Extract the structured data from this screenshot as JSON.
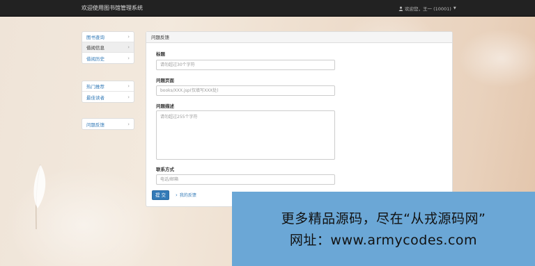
{
  "navbar": {
    "brand": "欢迎使用图书馆管理系统",
    "user_label": "欢迎您，王一 (10001)"
  },
  "sidebar": {
    "group1": [
      {
        "label": "图书查询",
        "active": false
      },
      {
        "label": "借阅信息",
        "active": true
      },
      {
        "label": "借阅历史",
        "active": false
      }
    ],
    "group2": [
      {
        "label": "热门推荐",
        "active": false
      },
      {
        "label": "最佳读者",
        "active": false
      }
    ],
    "group3": [
      {
        "label": "问题反馈",
        "active": false
      }
    ]
  },
  "panel": {
    "heading": "问题反馈",
    "title_label": "标题",
    "title_placeholder": "请勿超过30个字符",
    "page_label": "问题页面",
    "page_placeholder": "books/XXX.jsp(仅填写XXX处)",
    "desc_label": "问题描述",
    "desc_placeholder": "请勿超过255个字符",
    "contact_label": "联系方式",
    "contact_placeholder": "电话/邮箱",
    "submit_label": "提 交",
    "my_feedback_link": "我的反馈"
  },
  "watermark": {
    "line1": "更多精品源码，尽在“从戎源码网”",
    "line2": "网址：www.armycodes.com"
  },
  "colors": {
    "navbar_bg": "#222222",
    "link": "#337ab7",
    "primary_button": "#337ab7",
    "watermark_bg": "#6ba7d6"
  }
}
